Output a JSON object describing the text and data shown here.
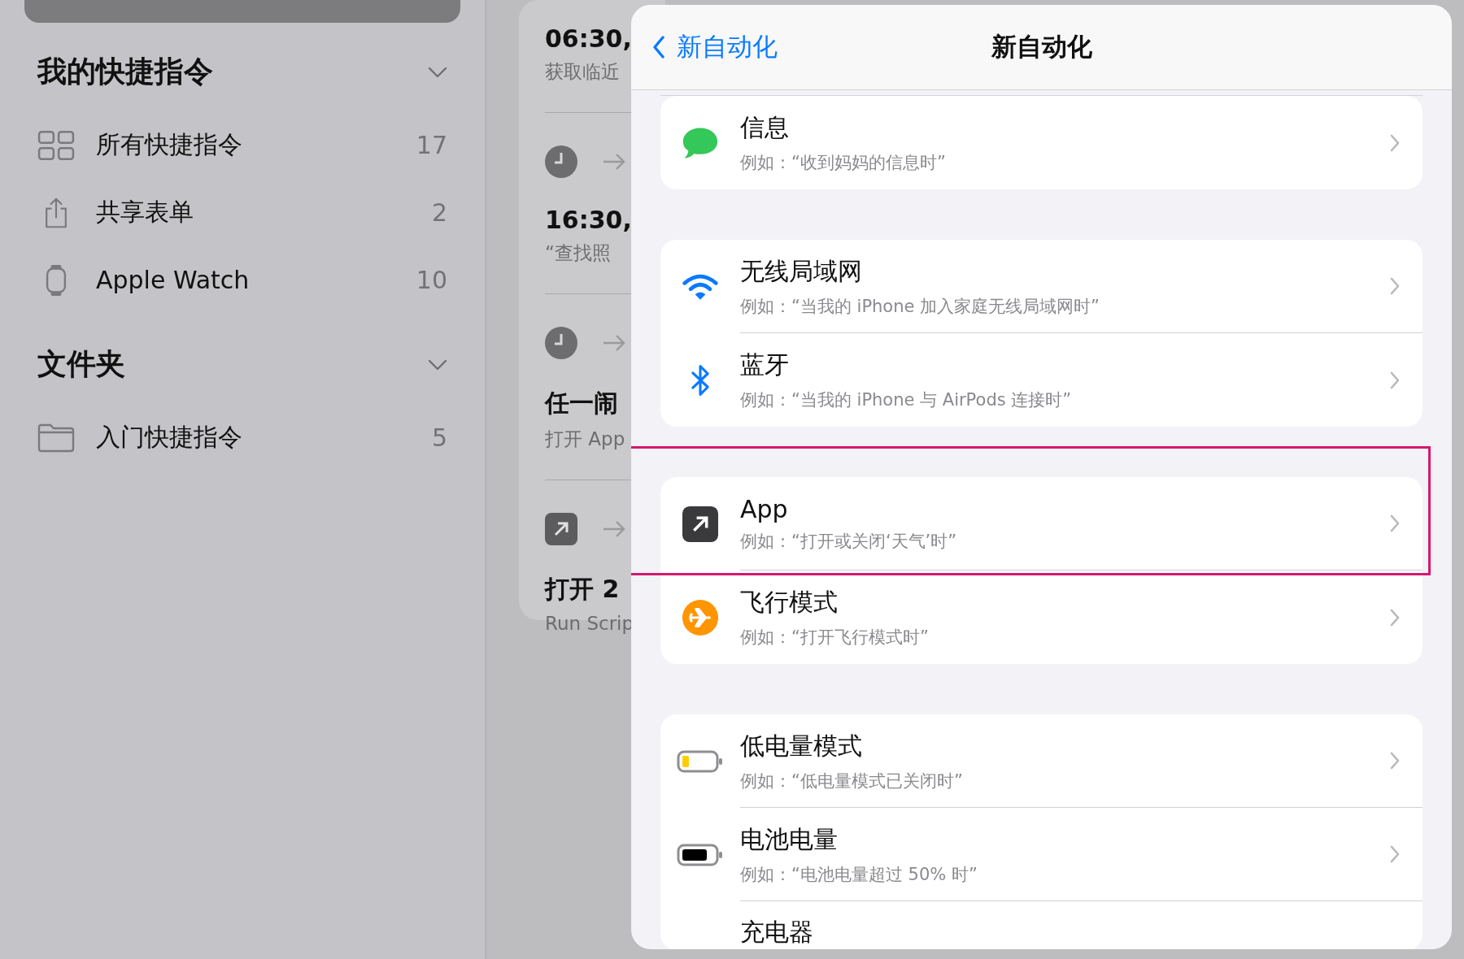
{
  "sidebar": {
    "sections": [
      {
        "title": "我的快捷指令",
        "expanded": true,
        "items": [
          {
            "kind": "grid",
            "label": "所有快捷指令",
            "count": "17"
          },
          {
            "kind": "share",
            "label": "共享表单",
            "count": "2"
          },
          {
            "kind": "watch",
            "label": "Apple Watch",
            "count": "10"
          }
        ]
      },
      {
        "title": "文件夹",
        "expanded": true,
        "items": [
          {
            "kind": "folder",
            "label": "入门快捷指令",
            "count": "5"
          }
        ]
      }
    ]
  },
  "automations": [
    {
      "kind": "plain",
      "title": "06:30,",
      "subtitle": "获取临近"
    },
    {
      "kind": "clock",
      "title": "16:30,",
      "subtitle": "“查找照"
    },
    {
      "kind": "clock",
      "title": "任一闹",
      "subtitle": "打开 App"
    },
    {
      "kind": "app",
      "title": "打开 2",
      "subtitle": "Run Scrip"
    }
  ],
  "modal": {
    "back_label": "新自动化",
    "title": "新自动化",
    "groups": [
      {
        "rows": [
          {
            "kind": "message",
            "title": "信息",
            "subtitle": "例如：“收到妈妈的信息时”",
            "highlighted": false
          }
        ]
      },
      {
        "rows": [
          {
            "kind": "wifi",
            "title": "无线局域网",
            "subtitle": "例如：“当我的 iPhone 加入家庭无线局域网时”",
            "highlighted": false
          },
          {
            "kind": "bluetooth",
            "title": "蓝牙",
            "subtitle": "例如：“当我的 iPhone 与 AirPods 连接时”",
            "highlighted": false
          }
        ]
      },
      {
        "rows": [
          {
            "kind": "app",
            "title": "App",
            "subtitle": "例如：“打开或关闭‘天气’时”",
            "highlighted": true
          },
          {
            "kind": "airplane",
            "title": "飞行模式",
            "subtitle": "例如：“打开飞行模式时”",
            "highlighted": false
          }
        ]
      },
      {
        "rows": [
          {
            "kind": "battery-low",
            "title": "低电量模式",
            "subtitle": "例如：“低电量模式已关闭时”",
            "highlighted": false
          },
          {
            "kind": "battery-full",
            "title": "电池电量",
            "subtitle": "例如：“电池电量超过 50% 时”",
            "highlighted": false
          },
          {
            "kind": "plain",
            "title": "充电器",
            "highlighted": false
          }
        ]
      }
    ]
  }
}
